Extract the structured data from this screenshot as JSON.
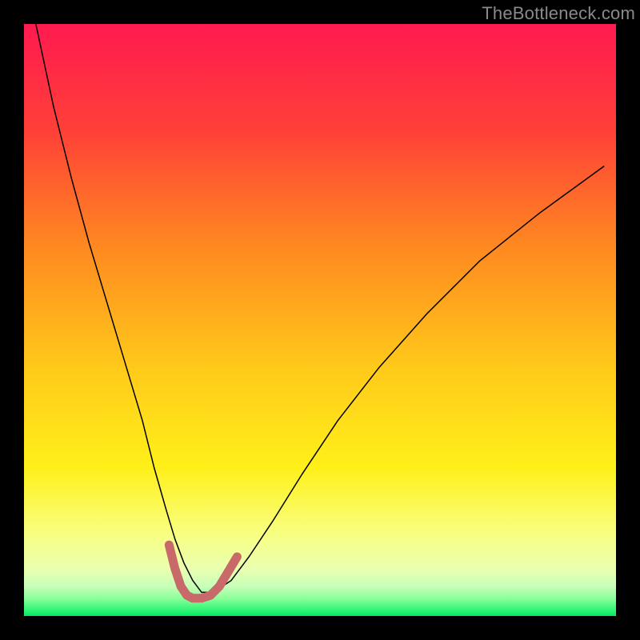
{
  "watermark": "TheBottleneck.com",
  "chart_data": {
    "type": "line",
    "title": "",
    "xlabel": "",
    "ylabel": "",
    "xlim": [
      0,
      100
    ],
    "ylim": [
      0,
      100
    ],
    "grid": false,
    "legend": false,
    "background_gradient": {
      "top_color": "#ff1a50",
      "mid_colors": [
        "#ff6a2a",
        "#ffd21a",
        "#f7ff7a"
      ],
      "bottom_color": "#00f264"
    },
    "series": [
      {
        "name": "bottleneck-curve",
        "stroke": "#000000",
        "stroke_width": 1.5,
        "x": [
          2,
          5,
          8,
          11,
          14,
          17,
          20,
          22,
          24,
          25.5,
          27,
          28.5,
          30,
          32,
          35,
          38,
          42,
          47,
          53,
          60,
          68,
          77,
          87,
          98
        ],
        "values": [
          100,
          86,
          74,
          63,
          53,
          43,
          33,
          25,
          18,
          13,
          9,
          6,
          4,
          4,
          6,
          10,
          16,
          24,
          33,
          42,
          51,
          60,
          68,
          76
        ]
      },
      {
        "name": "highlight-minimum",
        "stroke": "#c96a6a",
        "stroke_width": 11,
        "stroke_linecap": "round",
        "x": [
          24.5,
          25.5,
          26.5,
          27.5,
          28.5,
          30,
          31.5,
          33,
          34.5,
          36
        ],
        "values": [
          12,
          8,
          5,
          3.5,
          3,
          3,
          3.5,
          5,
          7.5,
          10
        ]
      }
    ]
  }
}
